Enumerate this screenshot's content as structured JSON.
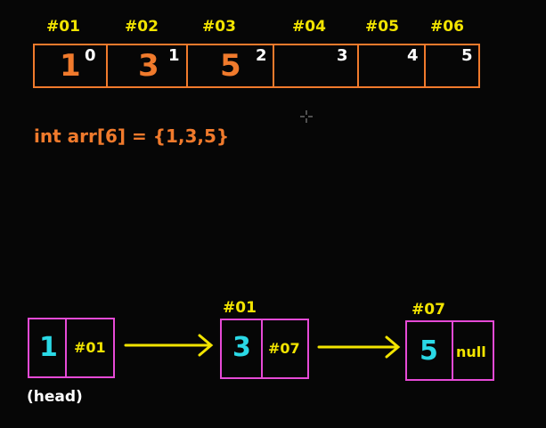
{
  "array": {
    "addresses": [
      "#01",
      "#02",
      "#03",
      "#04",
      "#05",
      "#06"
    ],
    "values": [
      "1",
      "3",
      "5",
      "",
      "",
      ""
    ],
    "indices": [
      "0",
      "1",
      "2",
      "3",
      "4",
      "5"
    ],
    "declaration": "int arr[6] = {1,3,5}"
  },
  "linked_list": {
    "nodes": [
      {
        "value": "1",
        "next": "#01",
        "address": ""
      },
      {
        "value": "3",
        "next": "#07",
        "address": "#01"
      },
      {
        "value": "5",
        "next": "null",
        "address": "#07"
      }
    ],
    "head_label": "(head)"
  },
  "colors": {
    "background": "#060606",
    "array_border": "#f07a2c",
    "array_value": "#f07a2c",
    "address": "#f2e400",
    "index": "#ffffff",
    "node_border": "#e64ad6",
    "node_value": "#2ad9e6",
    "arrow": "#f2e400"
  },
  "icons": {
    "cursor": "crosshair-cursor-icon"
  }
}
